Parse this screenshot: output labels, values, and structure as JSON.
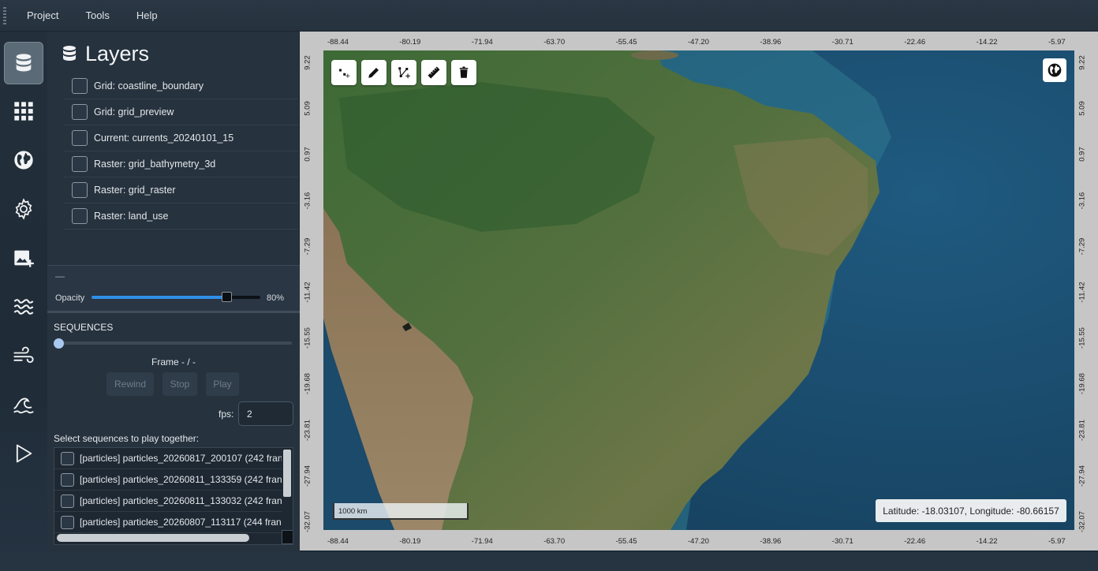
{
  "menu": {
    "items": [
      "Project",
      "Tools",
      "Help"
    ]
  },
  "sidebar_icons": [
    "database-icon",
    "grid-icon",
    "globe-icon",
    "settings-icon",
    "add-image-icon",
    "waves-icon",
    "wind-icon",
    "tide-icon",
    "play-icon"
  ],
  "layers": {
    "title": "Layers",
    "items": [
      {
        "label": "Grid: coastline_boundary",
        "checked": false
      },
      {
        "label": "Grid: grid_preview",
        "checked": false
      },
      {
        "label": "Current: currents_20240101_15",
        "checked": false
      },
      {
        "label": "Raster: grid_bathymetry_3d",
        "checked": false
      },
      {
        "label": "Raster: grid_raster",
        "checked": false
      },
      {
        "label": "Raster: land_use",
        "checked": false
      }
    ]
  },
  "opacity": {
    "dash": "—",
    "label": "Opacity",
    "value": 80,
    "value_label": "80%"
  },
  "sequences": {
    "title": "SEQUENCES",
    "frame_label": "Frame - / -",
    "buttons": {
      "rewind": "Rewind",
      "stop": "Stop",
      "play": "Play"
    },
    "fps_label": "fps:",
    "fps_value": "2",
    "select_label": "Select sequences to play together:",
    "items": [
      {
        "label": "[particles]  particles_20260817_200107  (242 fran"
      },
      {
        "label": "[particles]  particles_20260811_133359  (242 fran"
      },
      {
        "label": "[particles]  particles_20260811_133032  (242 fran"
      },
      {
        "label": "[particles]  particles_20260807_113117  (244 fran"
      }
    ]
  },
  "map": {
    "x_ticks": [
      "-88.44",
      "-80.19",
      "-71.94",
      "-63.70",
      "-55.45",
      "-47.20",
      "-38.96",
      "-30.71",
      "-22.46",
      "-14.22",
      "-5.97"
    ],
    "y_ticks": [
      "9.22",
      "5.09",
      "0.97",
      "-3.16",
      "-7.29",
      "-11.42",
      "-15.55",
      "-19.68",
      "-23.81",
      "-27.94",
      "-32.07"
    ],
    "tools": [
      "add-point-icon",
      "pencil-icon",
      "polyline-icon",
      "ruler-icon",
      "trash-icon"
    ],
    "scale_label": "1000 km",
    "coords_label": "Latitude: -18.03107, Longitude: -80.66157"
  }
}
